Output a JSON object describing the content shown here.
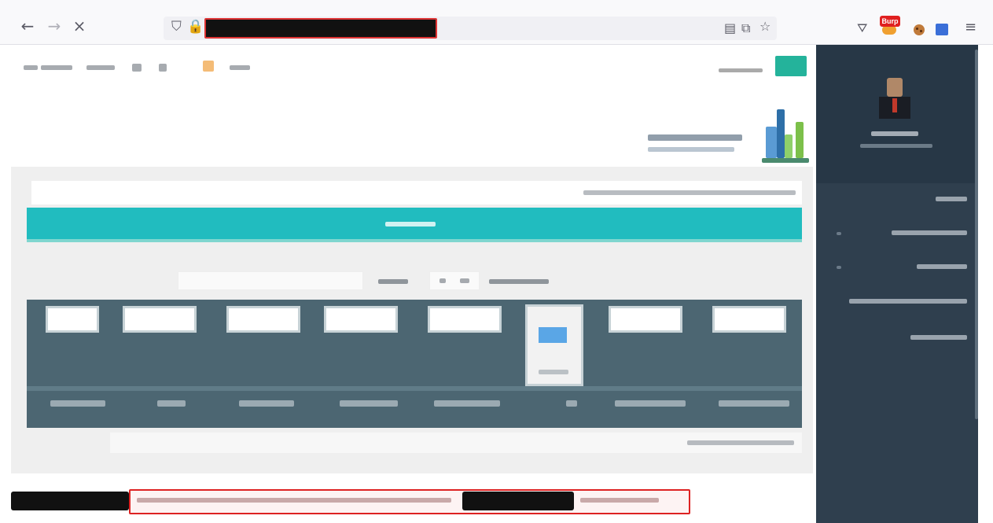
{
  "browser": {
    "back_icon": "back-arrow-icon",
    "forward_icon": "forward-arrow-icon",
    "stop_icon": "close-icon",
    "back_glyph": "←",
    "forward_glyph": "→",
    "stop_glyph": "×",
    "url": "",
    "extensions": {
      "burp_label": "Burp"
    }
  },
  "colors": {
    "accent_teal": "#21bcbf",
    "login_green": "#24b39b",
    "sidebar_dark": "#2f3f4e",
    "grid_panel": "#4c6672",
    "redaction_red": "#d22222"
  },
  "page": {
    "top_links_count": 6,
    "login_button_label": "",
    "teal_title": "",
    "grid_tiles_count": 8,
    "sidebar_items_count": 5
  }
}
